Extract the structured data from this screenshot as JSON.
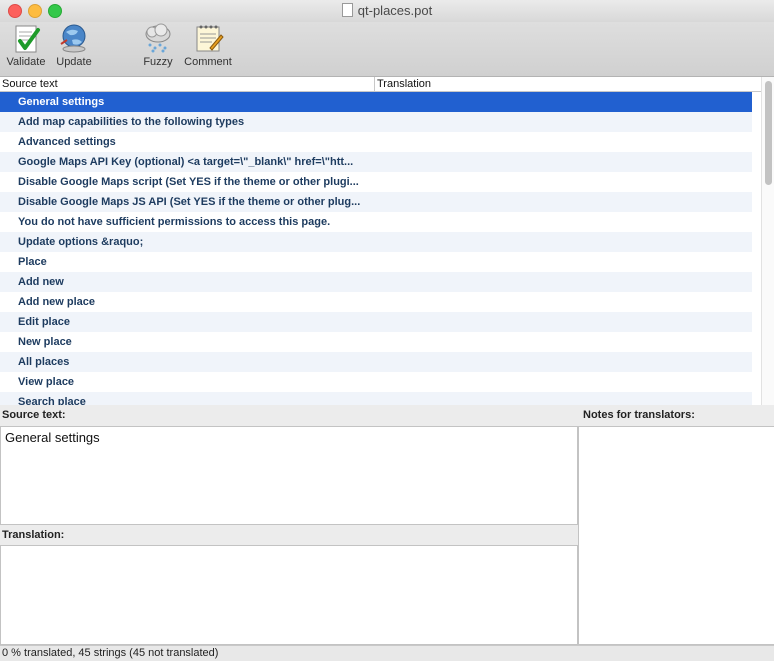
{
  "window": {
    "title": "qt-places.pot"
  },
  "toolbar": {
    "validate": "Validate",
    "update": "Update",
    "fuzzy": "Fuzzy",
    "comment": "Comment"
  },
  "list": {
    "col_source": "Source text",
    "col_translation": "Translation",
    "rows": [
      "General settings",
      "Add map capabilities to the following types",
      "Advanced settings",
      "Google Maps API Key (optional) <a target=\\\"_blank\\\" href=\\\"htt...",
      "Disable Google Maps script (Set YES if the theme or other plugi...",
      "Disable Google Maps JS API (Set YES if the theme or other plug...",
      "You do not have sufficient permissions to access this page.",
      "Update options &raquo;",
      "Place",
      "Add new",
      "Add new place",
      "Edit place",
      "New place",
      "All places",
      "View place",
      "Search place"
    ]
  },
  "source_pane": {
    "label": "Source text:",
    "value": "General settings"
  },
  "translation_pane": {
    "label": "Translation:",
    "value": ""
  },
  "notes_pane": {
    "label": "Notes for translators:",
    "value": ""
  },
  "status": {
    "text": "0 % translated, 45 strings (45 not translated)"
  },
  "colors": {
    "selection": "#2160d0",
    "row_text": "#1d3b5f"
  }
}
